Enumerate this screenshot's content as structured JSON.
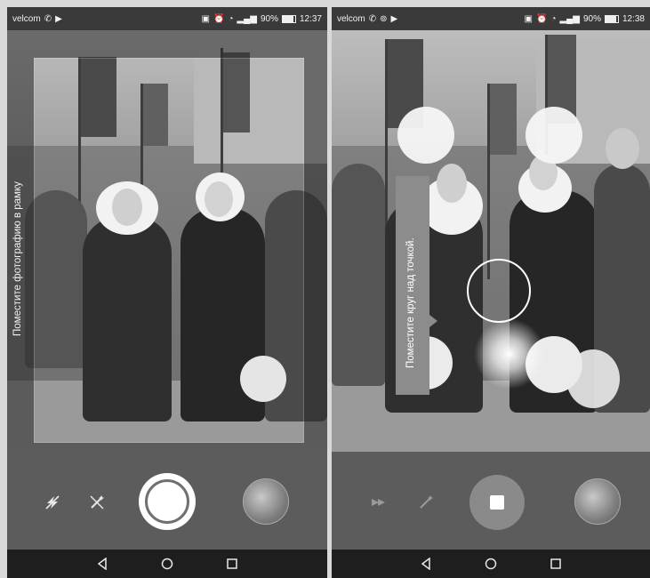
{
  "left_screen": {
    "status": {
      "carrier": "velcom",
      "battery": "90%",
      "time": "12:37"
    },
    "hint": "Поместите фотографию в рамку",
    "controls": {
      "flash_icon": "flash-off-icon",
      "magic_icon": "magic-wand-icon",
      "shutter": "shutter-icon",
      "thumbnail": "gallery-thumbnail"
    }
  },
  "right_screen": {
    "status": {
      "carrier": "velcom",
      "battery": "90%",
      "time": "12:38"
    },
    "tooltip": "Поместите круг над точкой.",
    "controls": {
      "flash_icon": "flash-icon",
      "magic_icon": "magic-wand-icon",
      "stop": "stop-icon",
      "thumbnail": "gallery-thumbnail"
    }
  },
  "nav": {
    "back": "back-icon",
    "home": "home-icon",
    "recents": "recents-icon"
  },
  "colors": {
    "status_bar": "#3a3a3a",
    "nav_bar": "#1e1e1e",
    "controls": "#5c5c5c",
    "tooltip": "#8c8c8c"
  }
}
